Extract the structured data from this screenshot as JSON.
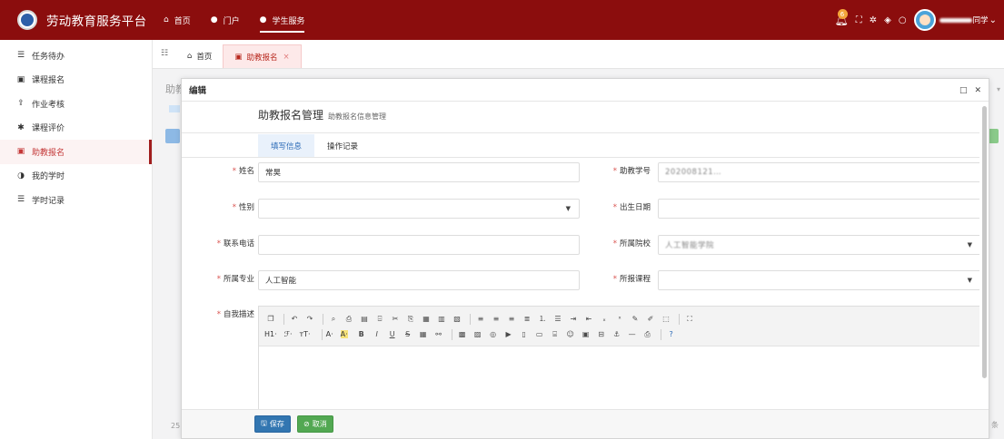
{
  "header": {
    "title": "劳动教育服务平台",
    "nav": [
      {
        "label": "首页",
        "icon": "home-icon"
      },
      {
        "label": "门户",
        "icon": "portal-icon"
      },
      {
        "label": "学生服务",
        "icon": "service-icon",
        "active": true
      }
    ],
    "notification_count": "6",
    "user_name": "同学"
  },
  "sidebar": {
    "items": [
      {
        "label": "任务待办",
        "icon": "list-icon"
      },
      {
        "label": "课程报名",
        "icon": "card-icon"
      },
      {
        "label": "作业考核",
        "icon": "upload-icon"
      },
      {
        "label": "课程评价",
        "icon": "gear-icon"
      },
      {
        "label": "助教报名",
        "icon": "card-icon",
        "active": true
      },
      {
        "label": "我的学时",
        "icon": "clock-icon"
      },
      {
        "label": "学时记录",
        "icon": "list-icon"
      }
    ]
  },
  "tabs": [
    {
      "label": "首页"
    },
    {
      "label": "助教报名",
      "active": true,
      "close": "×"
    }
  ],
  "background": {
    "title": "助教",
    "footer_left": "25",
    "footer_right": "条"
  },
  "dialog": {
    "title": "编辑",
    "form_title": "助教报名管理",
    "form_subtitle": "助教报名信息管理",
    "subtabs": [
      "填写信息",
      "操作记录"
    ],
    "fields": {
      "name": {
        "label": "姓名",
        "value": "常昊"
      },
      "assistant_id": {
        "label": "助教学号",
        "value": "202008121…"
      },
      "gender": {
        "label": "性别",
        "value": ""
      },
      "birth_date": {
        "label": "出生日期",
        "value": ""
      },
      "phone": {
        "label": "联系电话",
        "value": ""
      },
      "college": {
        "label": "所属院校",
        "value": "人工智能学院"
      },
      "major": {
        "label": "所属专业",
        "value": "人工智能"
      },
      "course": {
        "label": "所报课程",
        "value": ""
      },
      "description": {
        "label": "自我描述"
      }
    },
    "required_mark": "*",
    "editor_toolbar_row2_text": [
      "H1·",
      "ℱ·",
      "тT·",
      "A·",
      "A·"
    ],
    "buttons": {
      "save": "保存",
      "cancel": "取消"
    }
  },
  "colors": {
    "topbar": "#8b0d0d",
    "active_red": "#c43838",
    "save_blue": "#3276b1",
    "cancel_green": "#52a852",
    "subtab_blue": "#2c6bb7"
  }
}
